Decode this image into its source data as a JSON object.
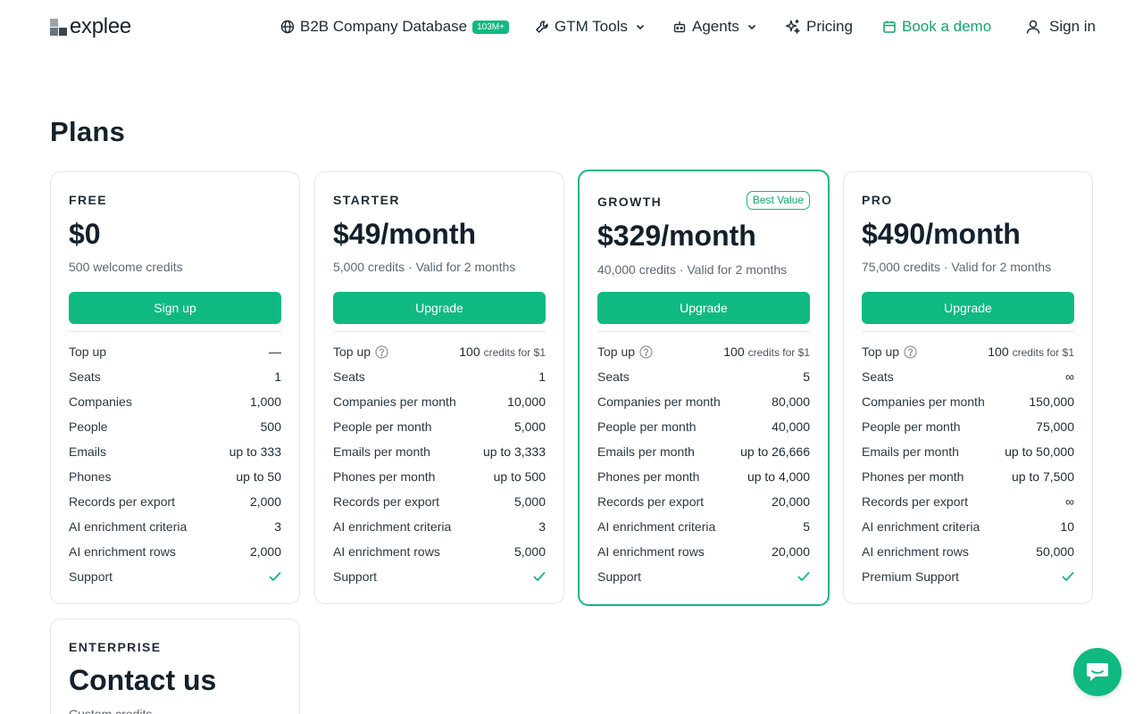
{
  "brand": {
    "name": "explee"
  },
  "nav": {
    "database_label": "B2B Company Database",
    "database_badge": "103M+",
    "gtm_label": "GTM Tools",
    "agents_label": "Agents",
    "pricing_label": "Pricing",
    "demo_label": "Book a demo",
    "signin_label": "Sign in"
  },
  "page": {
    "title": "Plans"
  },
  "plans": [
    {
      "tier": "FREE",
      "price": "$0",
      "subtitle": "500 welcome credits",
      "cta": "Sign up",
      "features": [
        {
          "label": "Top up",
          "value": "—"
        },
        {
          "label": "Seats",
          "value": "1"
        },
        {
          "label": "Companies",
          "value": "1,000"
        },
        {
          "label": "People",
          "value": "500"
        },
        {
          "label": "Emails",
          "value": "up to 333"
        },
        {
          "label": "Phones",
          "value": "up to 50"
        },
        {
          "label": "Records per export",
          "value": "2,000"
        },
        {
          "label": "AI enrichment criteria",
          "value": "3"
        },
        {
          "label": "AI enrichment rows",
          "value": "2,000"
        },
        {
          "label": "Support",
          "value": "check"
        }
      ]
    },
    {
      "tier": "STARTER",
      "price": "$49/month",
      "subtitle": "5,000 credits · Valid for 2 months",
      "cta": "Upgrade",
      "features": [
        {
          "label": "Top up",
          "value": "100",
          "value_suffix": "credits for $1"
        },
        {
          "label": "Seats",
          "value": "1"
        },
        {
          "label": "Companies per month",
          "value": "10,000"
        },
        {
          "label": "People per month",
          "value": "5,000"
        },
        {
          "label": "Emails per month",
          "value": "up to 3,333"
        },
        {
          "label": "Phones per month",
          "value": "up to 500"
        },
        {
          "label": "Records per export",
          "value": "5,000"
        },
        {
          "label": "AI enrichment criteria",
          "value": "3"
        },
        {
          "label": "AI enrichment rows",
          "value": "5,000"
        },
        {
          "label": "Support",
          "value": "check"
        }
      ]
    },
    {
      "tier": "GROWTH",
      "badge": "Best Value",
      "price": "$329/month",
      "subtitle": "40,000 credits · Valid for 2 months",
      "cta": "Upgrade",
      "features": [
        {
          "label": "Top up",
          "value": "100",
          "value_suffix": "credits for $1"
        },
        {
          "label": "Seats",
          "value": "5"
        },
        {
          "label": "Companies per month",
          "value": "80,000"
        },
        {
          "label": "People per month",
          "value": "40,000"
        },
        {
          "label": "Emails per month",
          "value": "up to 26,666"
        },
        {
          "label": "Phones per month",
          "value": "up to 4,000"
        },
        {
          "label": "Records per export",
          "value": "20,000"
        },
        {
          "label": "AI enrichment criteria",
          "value": "5"
        },
        {
          "label": "AI enrichment rows",
          "value": "20,000"
        },
        {
          "label": "Support",
          "value": "check"
        }
      ]
    },
    {
      "tier": "PRO",
      "price": "$490/month",
      "subtitle": "75,000 credits · Valid for 2 months",
      "cta": "Upgrade",
      "features": [
        {
          "label": "Top up",
          "value": "100",
          "value_suffix": "credits for $1"
        },
        {
          "label": "Seats",
          "value": "∞"
        },
        {
          "label": "Companies per month",
          "value": "150,000"
        },
        {
          "label": "People per month",
          "value": "75,000"
        },
        {
          "label": "Emails per month",
          "value": "up to 50,000"
        },
        {
          "label": "Phones per month",
          "value": "up to 7,500"
        },
        {
          "label": "Records per export",
          "value": "∞"
        },
        {
          "label": "AI enrichment criteria",
          "value": "10"
        },
        {
          "label": "AI enrichment rows",
          "value": "50,000"
        },
        {
          "label": "Premium Support",
          "value": "check"
        }
      ]
    }
  ],
  "enterprise": {
    "tier": "ENTERPRISE",
    "price": "Contact us",
    "subtitle": "Custom credits"
  },
  "colors": {
    "accent": "#10b981",
    "text": "#13202c",
    "border": "#e2e6ea"
  },
  "icons": {
    "database": "globe-icon",
    "gtm": "wrench-icon",
    "agents": "robot-icon",
    "pricing": "sparkle-icon",
    "demo": "calendar-icon",
    "signin": "user-icon",
    "chat": "chat-icon"
  }
}
